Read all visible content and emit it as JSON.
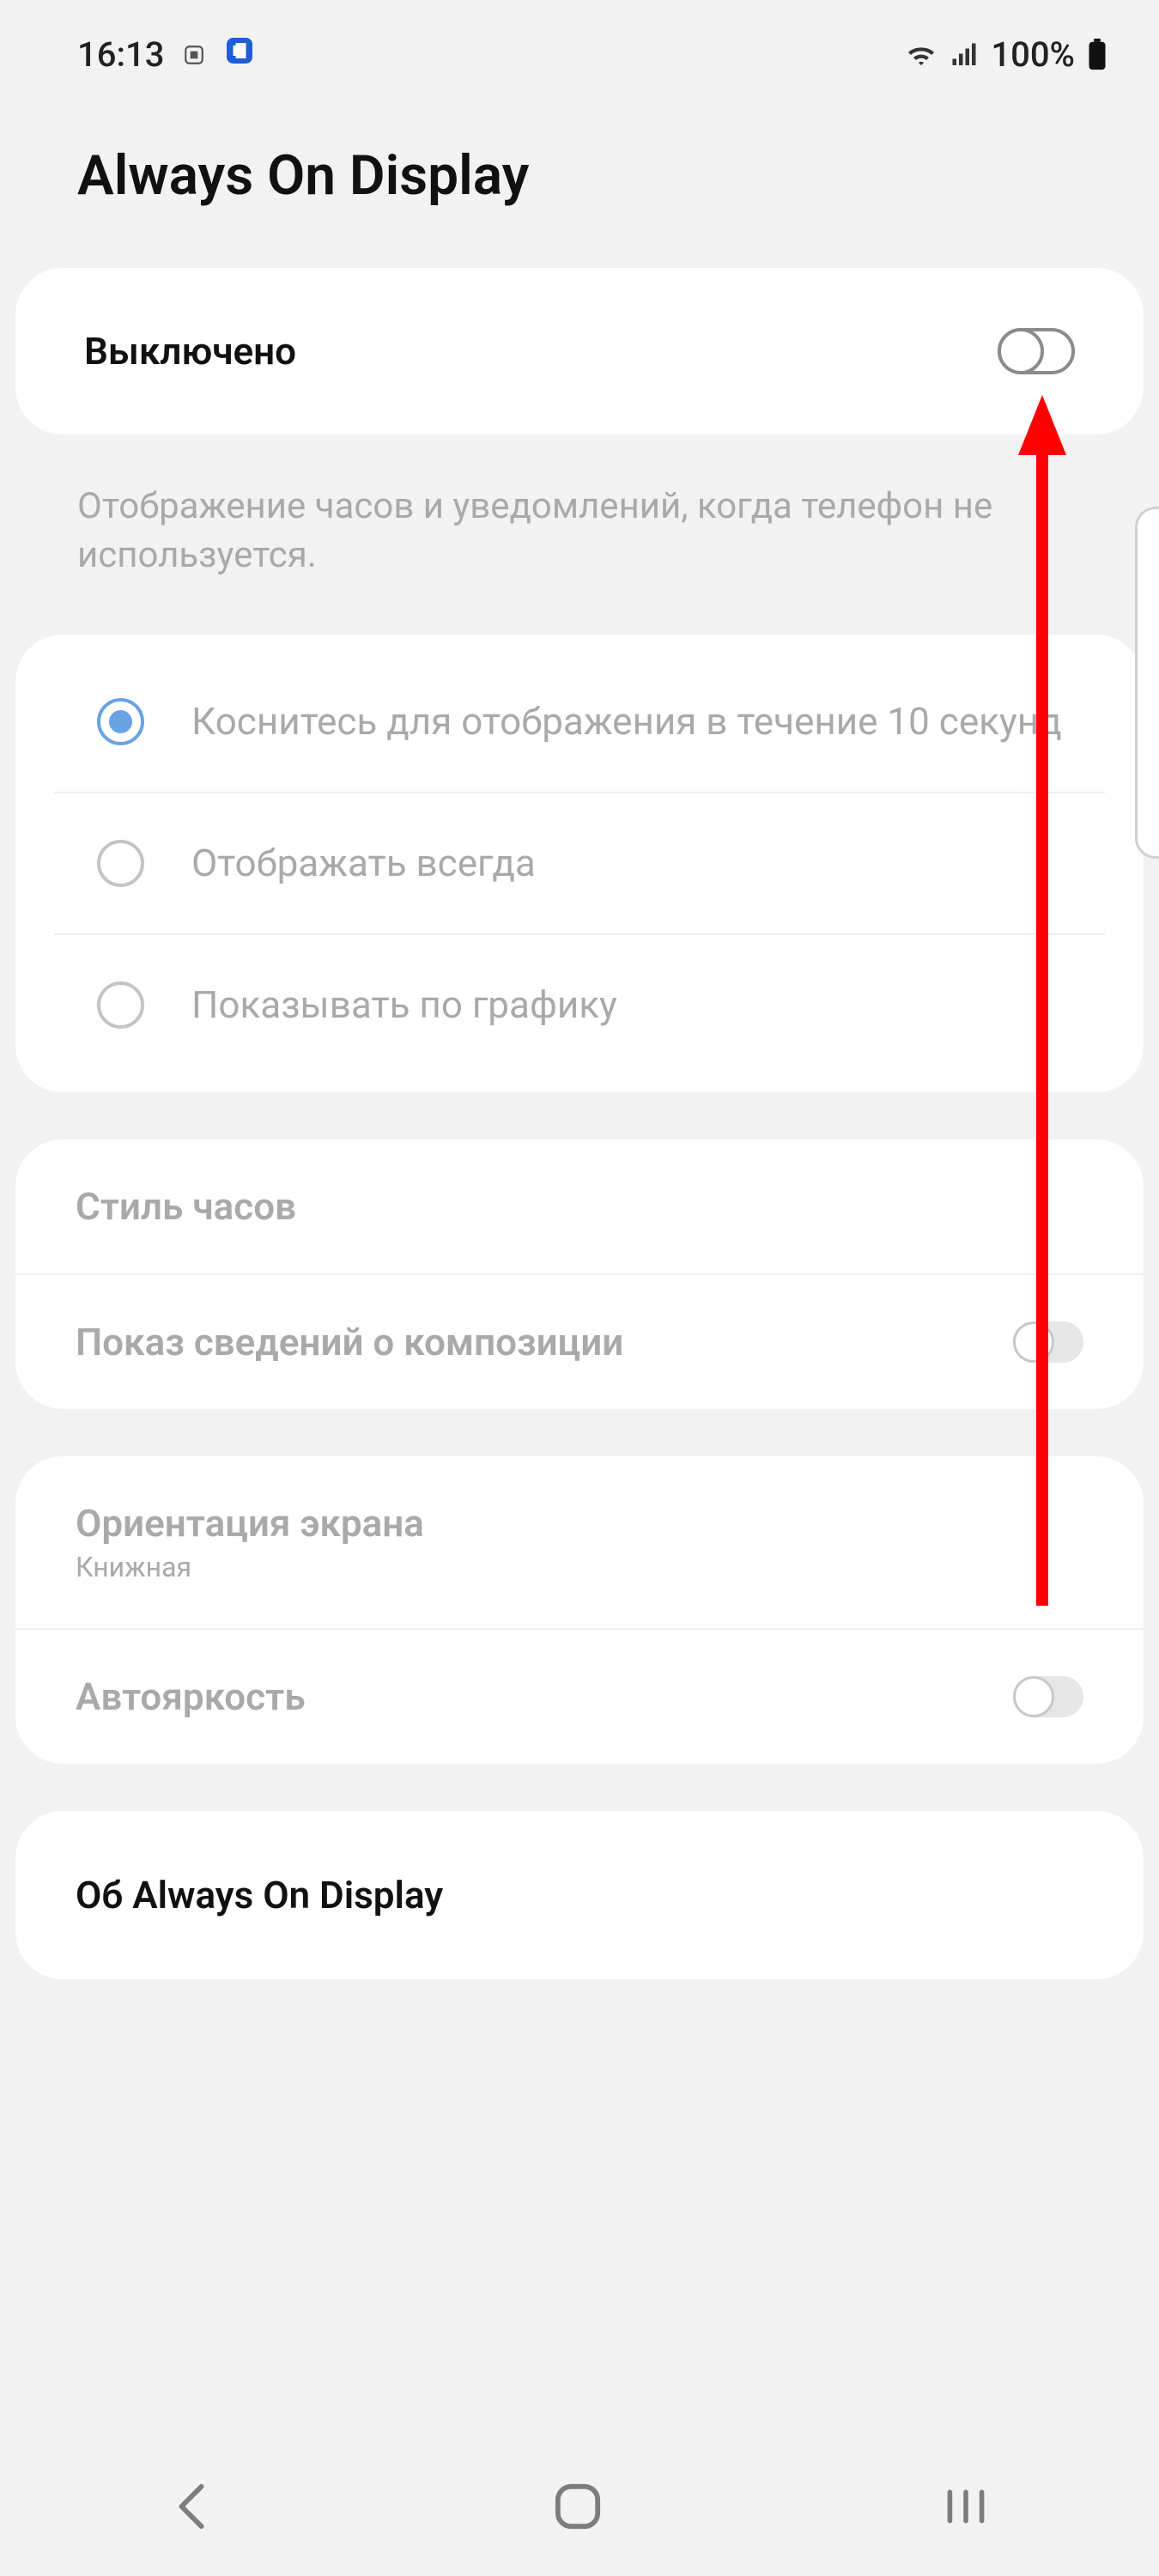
{
  "statusbar": {
    "time": "16:13",
    "battery_pct": "100%"
  },
  "header": {
    "title": "Always On Display"
  },
  "master": {
    "label": "Выключено",
    "on": false
  },
  "description": "Отображение часов и уведомлений, когда телефон не используется.",
  "modes": [
    {
      "label": "Коснитесь для отображения в течение 10 секунд",
      "selected": true
    },
    {
      "label": "Отображать всегда",
      "selected": false
    },
    {
      "label": "Показывать по графику",
      "selected": false
    }
  ],
  "settings": {
    "clock_style": {
      "label": "Стиль часов"
    },
    "music_info": {
      "label": "Показ сведений о композиции",
      "on": false
    },
    "orientation": {
      "label": "Ориентация экрана",
      "value": "Книжная"
    },
    "auto_bright": {
      "label": "Автояркость",
      "on": false
    },
    "about": {
      "label": "Об Always On Display"
    }
  }
}
